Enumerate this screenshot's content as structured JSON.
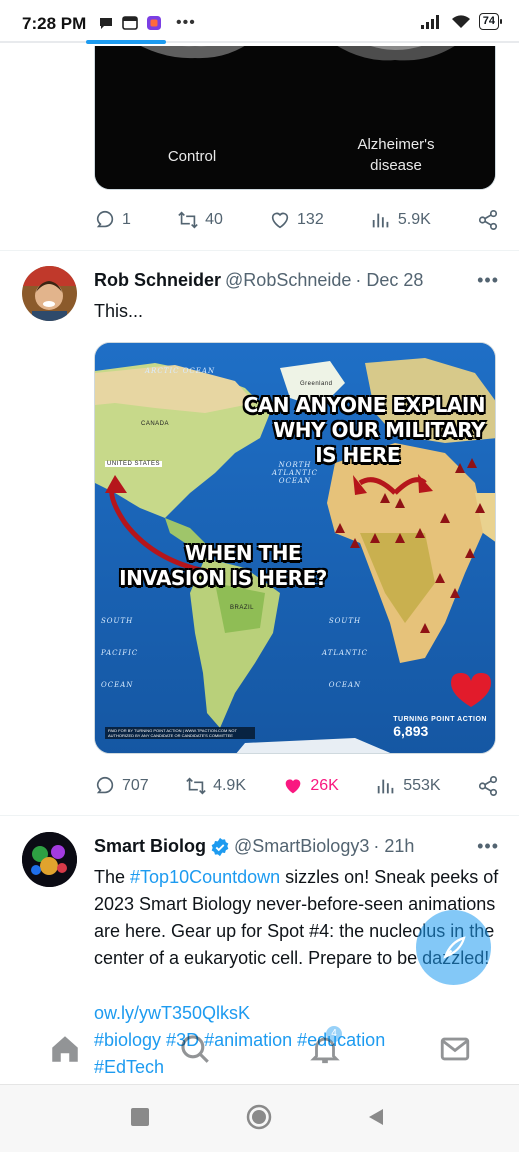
{
  "status_bar": {
    "time": "7:28 PM",
    "battery": "74",
    "overflow": "•••"
  },
  "prev_tweet": {
    "image_captions": [
      "Control",
      "Alzheimer's\ndisease"
    ],
    "replies": "1",
    "retweets": "40",
    "likes": "132",
    "views": "5.9K"
  },
  "tweet_rob": {
    "name": "Rob Schneider",
    "handle": "@RobSchneide",
    "date": "· Dec 28",
    "more": "•••",
    "text": "This...",
    "image": {
      "headline_top": [
        "CAN ANYONE EXPLAIN",
        "WHY OUR MILITARY",
        "IS HERE"
      ],
      "headline_bottom": [
        "WHEN THE",
        "INVASION IS HERE?"
      ],
      "labels": {
        "north_atlantic": "NORTH ATLANTIC OCEAN",
        "south_atlantic": "SOUTH ATLANTIC OCEAN",
        "south_pacific": "SOUTH PACIFIC OCEAN",
        "arctic": "ARCTIC OCEAN",
        "canada": "CANADA",
        "us": "UNITED STATES",
        "brazil": "BRAZIL",
        "greenland": "Greenland"
      },
      "badge_brand": "TURNING POINT ACTION",
      "badge_count": "6,893",
      "disclaimer": "PAID FOR BY TURNING POINT ACTION | WWW.TPACTION.COM NOT AUTHORIZED BY ANY CANDIDATE OR CANDIDATE'S COMMITTEE"
    },
    "replies": "707",
    "retweets": "4.9K",
    "likes": "26K",
    "views": "553K"
  },
  "tweet_smart": {
    "name": "Smart Biolog",
    "handle": "@SmartBiology3",
    "date": "· 21h",
    "more": "•••",
    "text_lines": {
      "pre_hashtag": "The ",
      "hashtag_1": "#Top10Countdown",
      "rest_1": " sizzles on! Sneak peeks of 2023 Smart Biology never-before-seen animations are here. Gear up for Spot #4: the nucleolus in the center of a eukaryotic cell. Prepare to be dazzled!",
      "link": "ow.ly/ywT350QlksK",
      "tags_line": "#biology #3D #animation #education",
      "tags_line_2": "#EdTech"
    }
  },
  "bottom_nav": {
    "notification_count": "4"
  },
  "colors": {
    "accent": "#1d9bf0",
    "like": "#f91880",
    "muted": "#536471"
  }
}
